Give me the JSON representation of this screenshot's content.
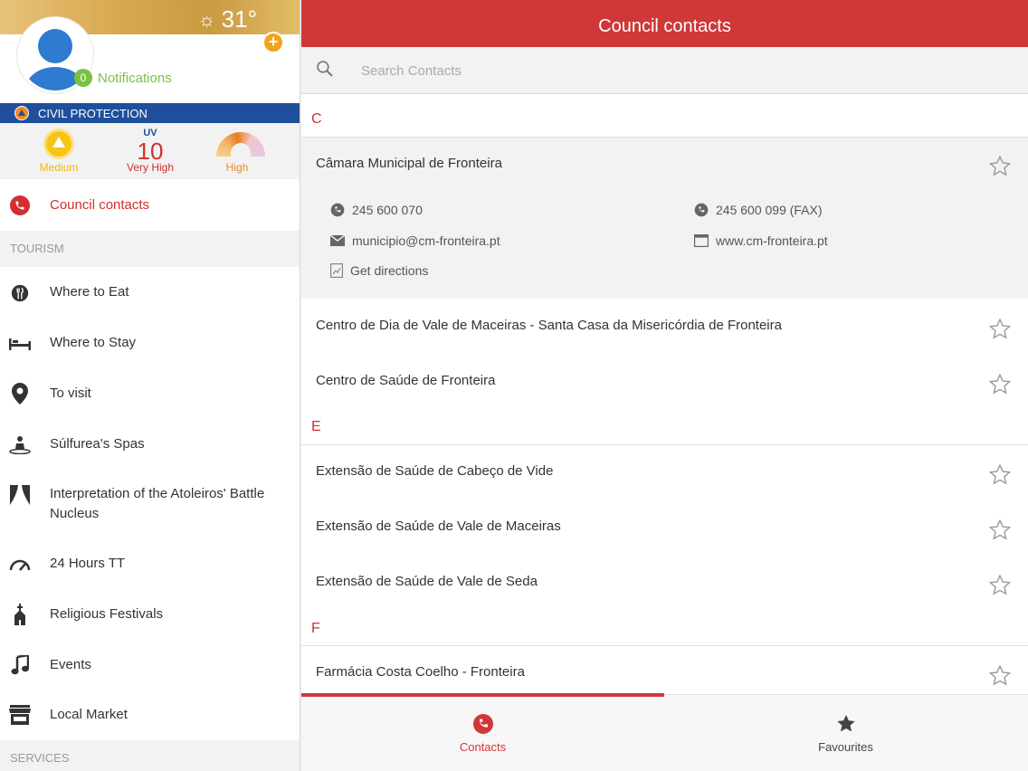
{
  "sidebar": {
    "weather": {
      "temperature": "31°"
    },
    "notifications": {
      "count": "0",
      "label": "Notifications"
    },
    "civil_protection": {
      "label": "CIVIL PROTECTION"
    },
    "risk": {
      "fire": {
        "label": "Medium",
        "color": "#f5b800"
      },
      "uv": {
        "title": "UV",
        "value": "10",
        "label": "Very High",
        "color": "#d32f2f"
      },
      "heat": {
        "label": "High",
        "color": "#f08a24"
      }
    },
    "council_contacts": "Council contacts",
    "tourism_header": "TOURISM",
    "items": [
      {
        "label": "Where to Eat",
        "icon": "restaurant-icon"
      },
      {
        "label": "Where to Stay",
        "icon": "bed-icon"
      },
      {
        "label": "To visit",
        "icon": "location-pin-icon"
      },
      {
        "label": "Súlfurea's Spas",
        "icon": "spa-icon"
      },
      {
        "label": "Interpretation of the Atoleiros' Battle Nucleus",
        "icon": "theater-icon"
      },
      {
        "label": "24 Hours TT",
        "icon": "speedometer-icon"
      },
      {
        "label": "Religious Festivals",
        "icon": "church-icon"
      },
      {
        "label": "Events",
        "icon": "music-icon"
      },
      {
        "label": "Local Market",
        "icon": "market-icon"
      }
    ],
    "services_header": "SERVICES"
  },
  "main": {
    "title": "Council contacts",
    "search": {
      "placeholder": "Search Contacts",
      "value": ""
    },
    "sections": [
      {
        "letter": "C"
      },
      {
        "letter": "E"
      },
      {
        "letter": "F"
      }
    ],
    "contacts": [
      {
        "name": "Câmara Municipal de Fronteira",
        "phone": "245 600 070",
        "fax": "245 600 099 (FAX)",
        "email": "municipio@cm-fronteira.pt",
        "website": "www.cm-fronteira.pt",
        "directions": "Get directions"
      },
      {
        "name": "Centro de Dia de Vale de Maceiras - Santa Casa da Misericórdia de Fronteira"
      },
      {
        "name": "Centro de Saúde de Fronteira"
      },
      {
        "name": "Extensão de Saúde de Cabeço de Vide"
      },
      {
        "name": "Extensão de Saúde de Vale de Maceiras"
      },
      {
        "name": "Extensão de Saúde de Vale de Seda"
      },
      {
        "name": "Farmácia Costa Coelho - Fronteira"
      }
    ],
    "tabs": [
      {
        "label": "Contacts",
        "icon": "phone-icon",
        "active": true
      },
      {
        "label": "Favourites",
        "icon": "star-icon",
        "active": false
      }
    ]
  },
  "colors": {
    "accent": "#d03737",
    "brand_blue": "#1f4f9c",
    "notification_green": "#7ac143"
  }
}
